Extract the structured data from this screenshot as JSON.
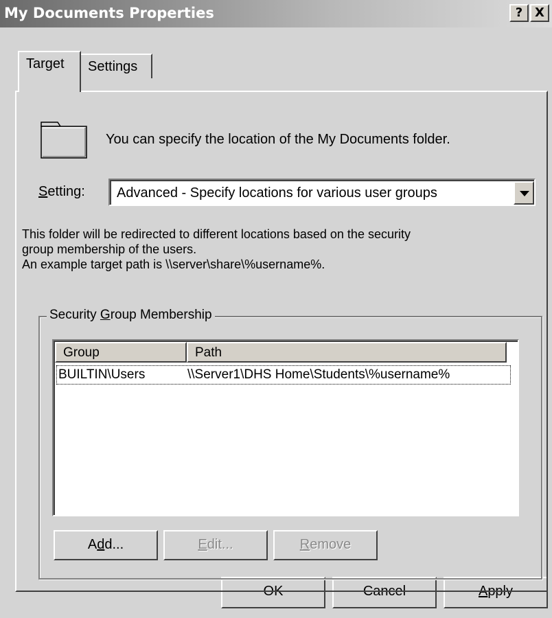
{
  "window": {
    "title": "My Documents Properties",
    "help_button": "?",
    "close_button": "X"
  },
  "tabs": [
    {
      "label": "Target",
      "selected": true
    },
    {
      "label": "Settings",
      "selected": false
    }
  ],
  "intro_text": "You can specify the location of the My Documents folder.",
  "setting": {
    "label_accel": "S",
    "label_rest": "etting:",
    "value": "Advanced - Specify locations for various user groups"
  },
  "description": [
    "This folder will be redirected to different locations based on the security",
    "group membership of the users.",
    "An example target path is \\\\server\\share\\%username%."
  ],
  "security_group": {
    "label_pre": "Security ",
    "label_accel": "G",
    "label_post": "roup Membership",
    "columns": [
      "Group",
      "Path"
    ],
    "rows": [
      {
        "group": "BUILTIN\\Users",
        "path": "\\\\Server1\\DHS Home\\Students\\%username%"
      }
    ],
    "buttons": {
      "add": {
        "pre": "A",
        "accel": "d",
        "post": "d..."
      },
      "edit": {
        "pre": "",
        "accel": "E",
        "post": "dit...",
        "enabled": false
      },
      "remove": {
        "pre": "",
        "accel": "R",
        "post": "emove",
        "enabled": false
      }
    }
  },
  "footer": {
    "ok": "OK",
    "cancel": "Cancel",
    "apply_accel": "A",
    "apply_rest": "pply"
  }
}
